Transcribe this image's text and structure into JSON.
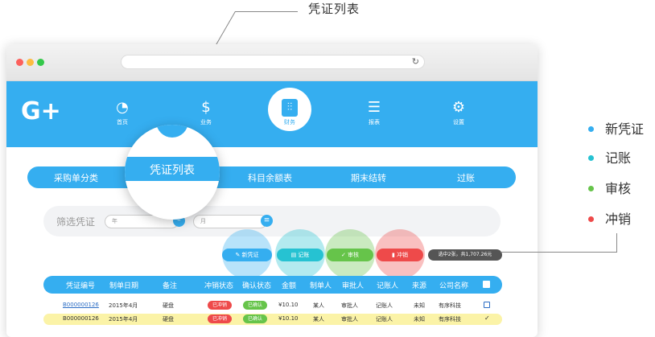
{
  "callout": {
    "title": "凭证列表"
  },
  "nav": {
    "logo": "G+",
    "items": [
      {
        "label": "首页",
        "icon": "gauge-icon"
      },
      {
        "label": "业务",
        "icon": "money-icon"
      },
      {
        "label": "财务",
        "icon": "sliders-icon"
      },
      {
        "label": "报表",
        "icon": "report-icon"
      },
      {
        "label": "设置",
        "icon": "gear-icon"
      }
    ]
  },
  "tabs": [
    "采购单分类",
    "凭证列表",
    "科目余额表",
    "期末结转",
    "过账"
  ],
  "filter": {
    "label": "筛选凭证",
    "year_placeholder": "年",
    "month_placeholder": "月"
  },
  "actions": [
    {
      "label": "新凭证",
      "color": "#35aef0"
    },
    {
      "label": "记账",
      "color": "#26c2d2"
    },
    {
      "label": "审核",
      "color": "#66c44a"
    },
    {
      "label": "冲销",
      "color": "#ee4a4a"
    }
  ],
  "selection_info": "选中2张，共1,707.26元",
  "table": {
    "headers": [
      "凭证编号",
      "制单日期",
      "备注",
      "冲销状态",
      "确认状态",
      "金额",
      "制单人",
      "审批人",
      "记账人",
      "来源",
      "公司名称"
    ],
    "rows": [
      {
        "id": "B000000126",
        "date": "2015年4月",
        "note": "硬盘",
        "reverse": "已冲销",
        "confirm": "已确认",
        "amount": "¥10.10",
        "maker": "某人",
        "approver": "审批人",
        "bookkeeper": "记账人",
        "source": "未知",
        "company": "有序科技"
      },
      {
        "id": "B000000126",
        "date": "2015年4月",
        "note": "硬盘",
        "reverse": "已冲销",
        "confirm": "已确认",
        "amount": "¥10.10",
        "maker": "某人",
        "approver": "审批人",
        "bookkeeper": "记账人",
        "source": "未知",
        "company": "有序科技"
      }
    ]
  },
  "legend": [
    {
      "label": "新凭证",
      "color": "#35aef0"
    },
    {
      "label": "记账",
      "color": "#26c2d2"
    },
    {
      "label": "审核",
      "color": "#66c44a"
    },
    {
      "label": "冲销",
      "color": "#ee4a4a"
    }
  ],
  "colors": {
    "primary": "#35aef0",
    "highlight_row": "#fbf3a7"
  }
}
